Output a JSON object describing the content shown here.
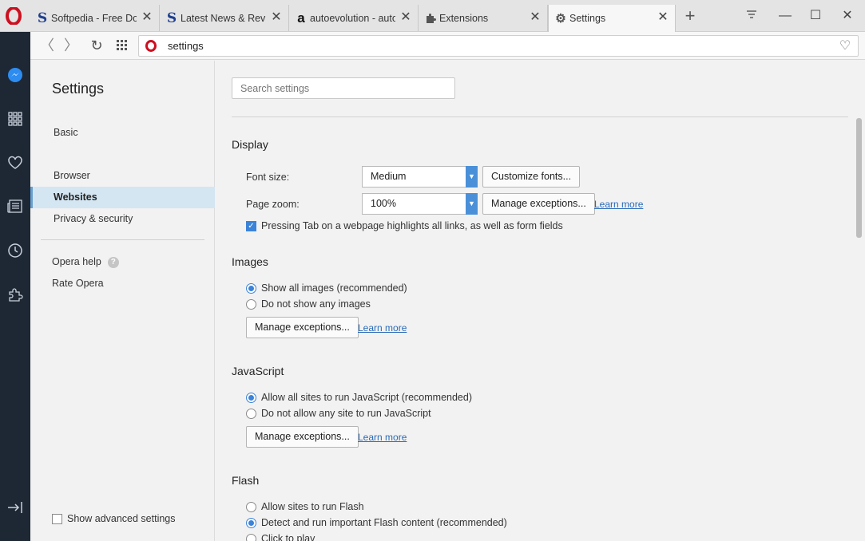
{
  "tabs": [
    {
      "label": "Softpedia - Free Dow",
      "favicon": "softpedia-s"
    },
    {
      "label": "Latest News & Revie",
      "favicon": "softpedia-s"
    },
    {
      "label": "autoevolution - auto",
      "favicon": "autoevolution-a"
    },
    {
      "label": "Extensions",
      "favicon": "puzzle-icon"
    },
    {
      "label": "Settings",
      "favicon": "gear-icon"
    }
  ],
  "address": {
    "url": "settings"
  },
  "nav": {
    "title": "Settings",
    "items": [
      "Basic",
      "Browser",
      "Websites",
      "Privacy & security"
    ],
    "help": "Opera help",
    "rate": "Rate Opera",
    "advanced": "Show advanced settings"
  },
  "search": {
    "placeholder": "Search settings"
  },
  "display": {
    "title": "Display",
    "font_size_label": "Font size:",
    "font_size_value": "Medium",
    "customize_fonts": "Customize fonts...",
    "page_zoom_label": "Page zoom:",
    "page_zoom_value": "100%",
    "manage_exceptions": "Manage exceptions...",
    "learn_more": "Learn more",
    "tab_highlight": "Pressing Tab on a webpage highlights all links, as well as form fields"
  },
  "images": {
    "title": "Images",
    "opt1": "Show all images (recommended)",
    "opt2": "Do not show any images",
    "manage_exceptions": "Manage exceptions...",
    "learn_more": "Learn more"
  },
  "javascript": {
    "title": "JavaScript",
    "opt1": "Allow all sites to run JavaScript (recommended)",
    "opt2": "Do not allow any site to run JavaScript",
    "manage_exceptions": "Manage exceptions...",
    "learn_more": "Learn more"
  },
  "flash": {
    "title": "Flash",
    "opt1": "Allow sites to run Flash",
    "opt2": "Detect and run important Flash content (recommended)",
    "opt3": "Click to play"
  },
  "colors": {
    "accent": "#3b83d8",
    "sidebar": "#1e2734",
    "opera_red": "#cc1020"
  }
}
